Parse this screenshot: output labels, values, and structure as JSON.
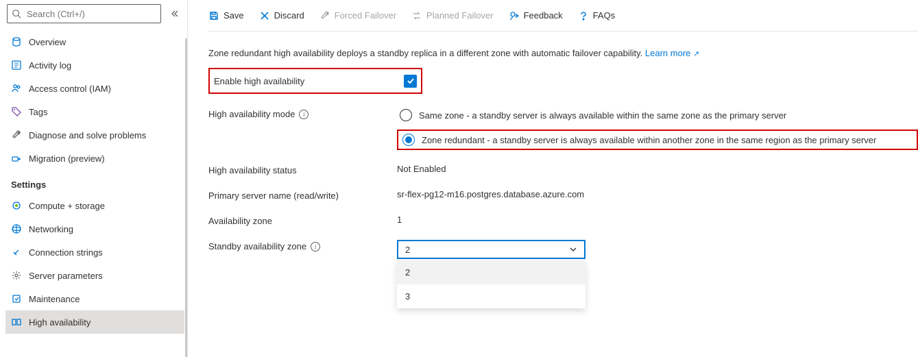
{
  "sidebar": {
    "search_placeholder": "Search (Ctrl+/)",
    "nav": [
      {
        "key": "overview",
        "label": "Overview"
      },
      {
        "key": "activity-log",
        "label": "Activity log"
      },
      {
        "key": "access-control",
        "label": "Access control (IAM)"
      },
      {
        "key": "tags",
        "label": "Tags"
      },
      {
        "key": "diagnose",
        "label": "Diagnose and solve problems"
      },
      {
        "key": "migration",
        "label": "Migration (preview)"
      }
    ],
    "settings_heading": "Settings",
    "settings": [
      {
        "key": "compute-storage",
        "label": "Compute + storage"
      },
      {
        "key": "networking",
        "label": "Networking"
      },
      {
        "key": "connection-strings",
        "label": "Connection strings"
      },
      {
        "key": "server-parameters",
        "label": "Server parameters"
      },
      {
        "key": "maintenance",
        "label": "Maintenance"
      },
      {
        "key": "high-availability",
        "label": "High availability",
        "active": true
      }
    ]
  },
  "toolbar": {
    "save": "Save",
    "discard": "Discard",
    "forced_failover": "Forced Failover",
    "planned_failover": "Planned Failover",
    "feedback": "Feedback",
    "faqs": "FAQs"
  },
  "content": {
    "description": "Zone redundant high availability deploys a standby replica in a different zone with automatic failover capability.",
    "learn_more": "Learn more",
    "enable_label": "Enable high availability",
    "ha_mode_label": "High availability mode",
    "ha_mode_options": {
      "same_zone": "Same zone - a standby server is always available within the same zone as the primary server",
      "zone_redundant": "Zone redundant - a standby server is always available within another zone in the same region as the primary server"
    },
    "ha_status_label": "High availability status",
    "ha_status_value": "Not Enabled",
    "primary_name_label": "Primary server name (read/write)",
    "primary_name_value": "sr-flex-pg12-m16.postgres.database.azure.com",
    "az_label": "Availability zone",
    "az_value": "1",
    "standby_label": "Standby availability zone",
    "standby_selected": "2",
    "standby_options": [
      "2",
      "3"
    ]
  }
}
